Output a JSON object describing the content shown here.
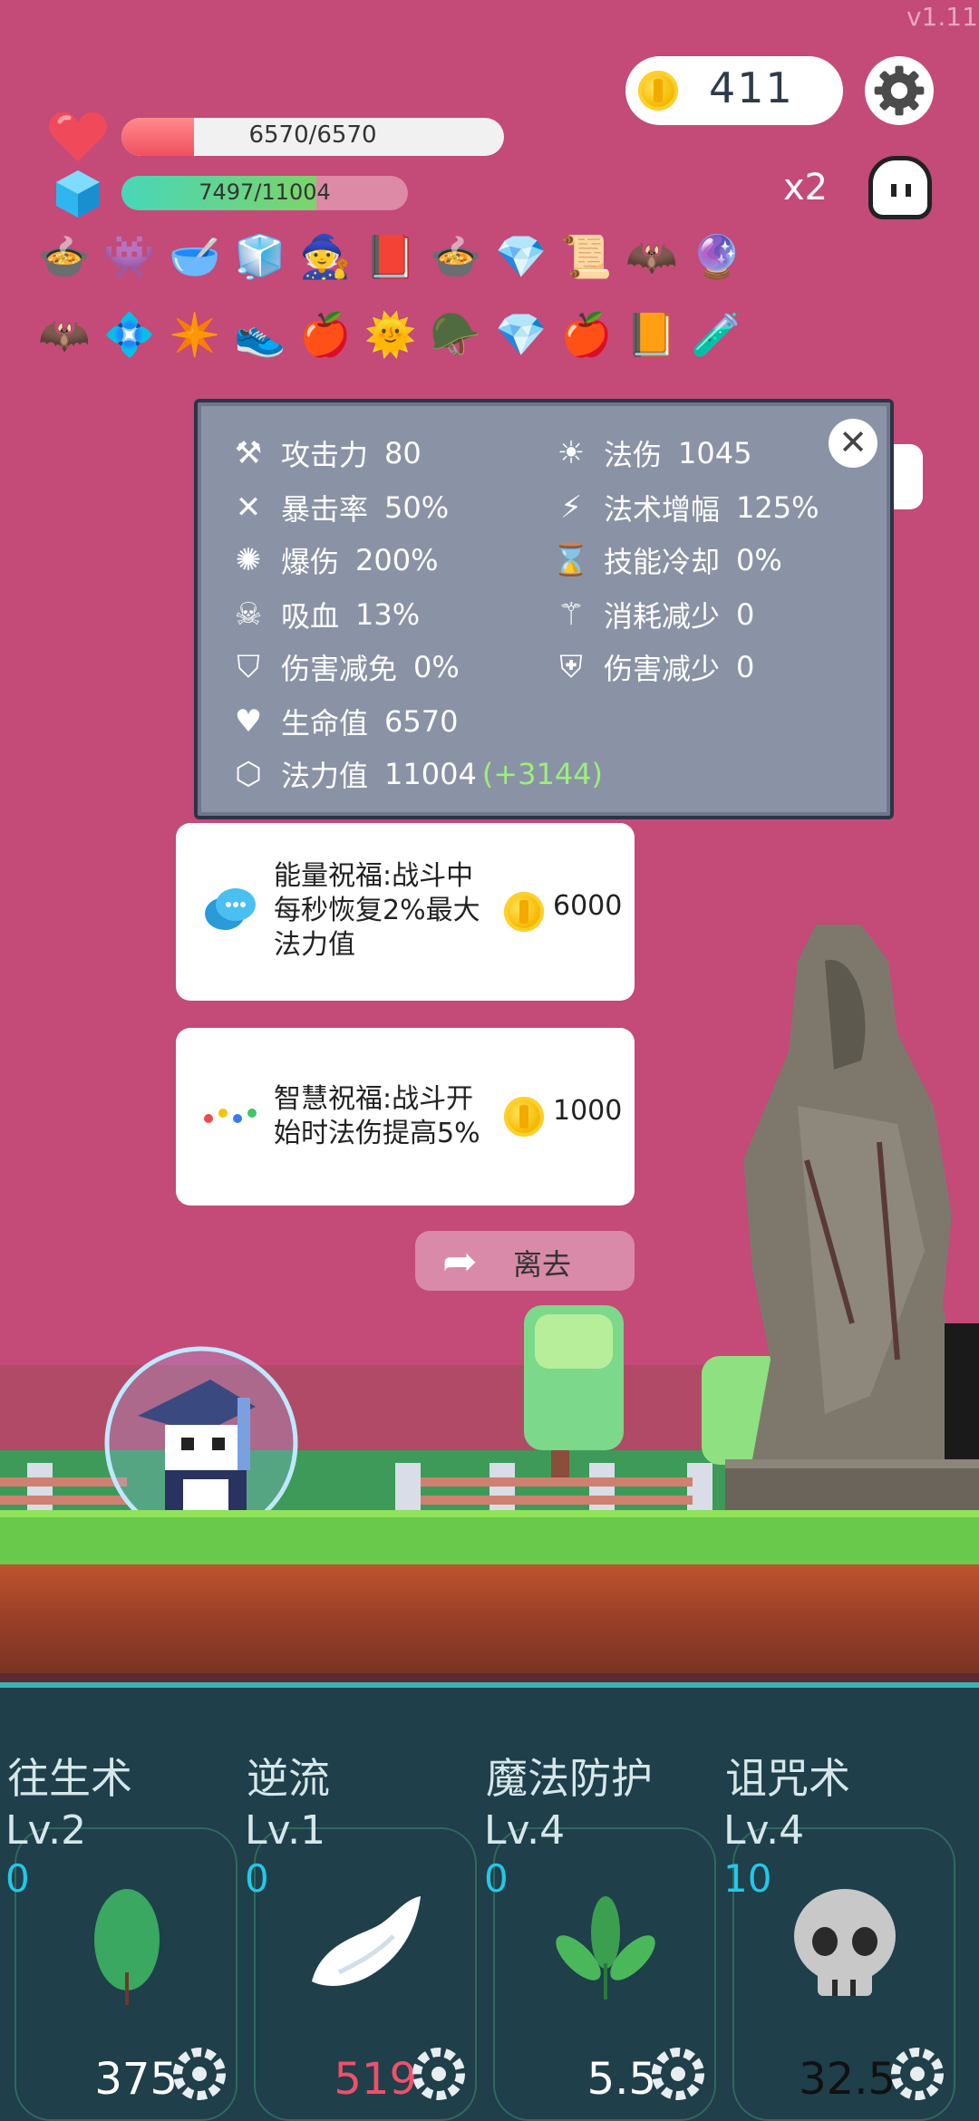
{
  "version": "v1.11",
  "coins": "411",
  "hp": {
    "text": "6570/6570",
    "fill": 0.19
  },
  "mp": {
    "text": "7497/11004",
    "fill": 0.68
  },
  "speed": "x2",
  "inventory_row1": [
    "🍲",
    "👾",
    "🥣",
    "🧊",
    "🧙",
    "📕",
    "🍲",
    "💎",
    "📜",
    "🦇",
    "🔮"
  ],
  "inventory_row2": [
    "🦇",
    "💠",
    "✴️",
    "👟",
    "🍎",
    "🌞",
    "🪖",
    "💎",
    "🍎",
    "📙",
    "🧪"
  ],
  "stats": {
    "attack": {
      "label": "攻击力",
      "value": "80"
    },
    "crit_rate": {
      "label": "暴击率",
      "value": "50%"
    },
    "crit_dmg": {
      "label": "爆伤",
      "value": "200%"
    },
    "lifesteal": {
      "label": "吸血",
      "value": "13%"
    },
    "dmg_immunity": {
      "label": "伤害减免",
      "value": "0%"
    },
    "hp": {
      "label": "生命值",
      "value": "6570"
    },
    "mana": {
      "label": "法力值",
      "value": "11004",
      "bonus": "(+3144)"
    },
    "spell_dmg": {
      "label": "法伤",
      "value": "1045"
    },
    "spell_amp": {
      "label": "法术增幅",
      "value": "125%"
    },
    "cooldown": {
      "label": "技能冷却",
      "value": "0%"
    },
    "cost_reduce": {
      "label": "消耗减少",
      "value": "0"
    },
    "dmg_reduce": {
      "label": "伤害减少",
      "value": "0"
    }
  },
  "cards": [
    {
      "text": "能量祝福:战斗中\n每秒恢复2%最大\n法力值",
      "price": "6000"
    },
    {
      "text": "智慧祝福:战斗开\n始时法伤提高5%",
      "price": "1000"
    }
  ],
  "leave_label": "离去",
  "skills": [
    {
      "name": "往生术",
      "level": "Lv.2",
      "count": "0",
      "value": "375",
      "value_color": "#ffffff"
    },
    {
      "name": "逆流",
      "level": "Lv.1",
      "count": "0",
      "value": "519",
      "value_color": "#f0506a"
    },
    {
      "name": "魔法防护",
      "level": "Lv.4",
      "count": "0",
      "value": "5.5",
      "value_color": "#ffffff"
    },
    {
      "name": "诅咒术",
      "level": "Lv.4",
      "count": "10",
      "value": "32.5",
      "value_color": "#111111"
    }
  ]
}
